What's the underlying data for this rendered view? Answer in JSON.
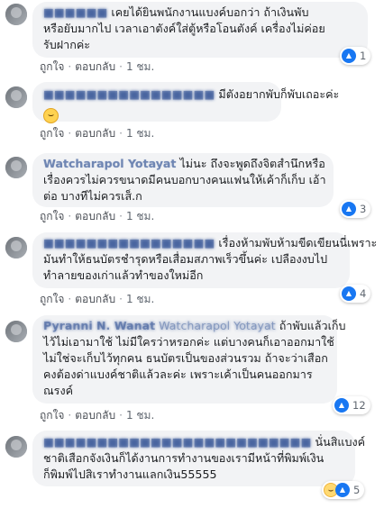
{
  "actions": {
    "like": "ถูกใจ",
    "reply": "ตอบกลับ"
  },
  "icons": {
    "like": "like-icon",
    "haha": "haha-icon"
  },
  "colors": {
    "bubble": "#f2f3f5",
    "name": "#385898",
    "like": "#1877f2"
  },
  "comments": [
    {
      "name": "■■■■■■",
      "line1": "เคยได้ยินพนักงานแบงค์บอกว่า ถ้าเงินพับ",
      "line2": "หรือยับมากไป เวลาเอาตังค์ใส่ตู้หรือโอนตังค์ เครื่องไม่ค่อย",
      "line3": "รับฝากค่ะ",
      "time": "1 ชม.",
      "reaction_count": "1"
    },
    {
      "name": "■■■■■■■■■■■■■■■■",
      "line1": "มีตังอยากพับก็พับเถอะค่ะ",
      "emoji": "😂",
      "time": "1 ชม."
    },
    {
      "name": "Watcharapol Yotayat",
      "line1": "ไม่นะ ถึงจะพูดถึงจิตสำนึกหรือ",
      "line2": "เรื่องควรไม่ควรขนาดมีคนบอกบางคนแฟนให้เค้าก็เก็บ เอ้า",
      "line3": "ต่อ บางทีไม่ควรเส็.ก",
      "time": "1 ชม.",
      "reaction_count": "3"
    },
    {
      "name": "■■■■■■■■■■■■■■■■",
      "line1": "เรื่องห้ามพับห้ามขีดเขียนนี่เพราะ",
      "line2": "มันทำให้ธนบัตรชำรุดหรือเสื่อมสภาพเร็วขึ้นค่ะ เปลืองงบไป",
      "line3": "ทำลายของเก่าแล้วทำของใหม่อีก",
      "time": "1 ชม.",
      "reaction_count": "4"
    },
    {
      "name": "Pyranni N. Wanat",
      "tag": "Watcharapol Yotayat",
      "line1": "ถ้าพับแล้วเก็บ",
      "line2": "ไว้ไม่เอามาใช้ ไม่มีใครว่าหรอกค่ะ แต่บางคนก็เอาออกมาใช้",
      "line3": "ไม่ใช่จะเก็บไว้ทุกคน ธนบัตรเป็นของส่วนรวม ถ้าจะว่าเสือก",
      "line4": "คงต้องด่าแบงค์ชาติแล้วละค่ะ เพราะเค้าเป็นคนออกมาร",
      "line5": "ณรงค์",
      "time": "1 ชม.",
      "reaction_count": "12"
    },
    {
      "name": "■■■■■■■■■■■■■■■■■■■■■■■■■",
      "line1": "นั่นสิแบงค์",
      "line2": "ชาติเสือกจังเงินก็ได้งานการทำงานของเรามีหน้าที่พิมพ์เงิน",
      "line3": "ก็พิมพ์ไปสิเราทำงานแลกเงิน55555",
      "time": "1 ชม.",
      "reaction_count": "5"
    }
  ]
}
